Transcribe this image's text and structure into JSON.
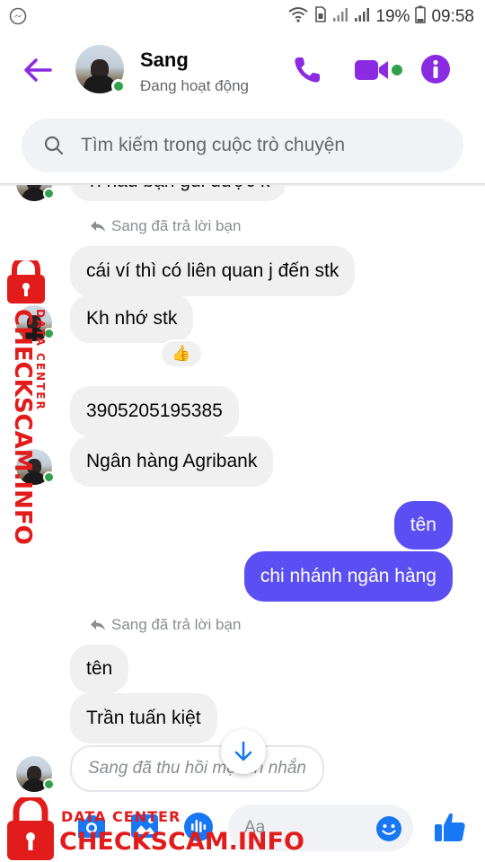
{
  "status_bar": {
    "battery": "19%",
    "time": "09:58"
  },
  "header": {
    "contact_name": "Sang",
    "contact_status": "Đang hoạt động"
  },
  "search": {
    "placeholder": "Tìm kiếm trong cuộc trò chuyện"
  },
  "messages": {
    "cut_off_top": "Ti nau bạn gui được k",
    "reply_note_1": "Sang đã trả lời bạn",
    "msg1": "cái ví thì có liên quan j đến stk",
    "msg2": "Kh nhớ stk",
    "reaction": "👍",
    "msg3": "3905205195385",
    "msg4": "Ngân hàng Agribank",
    "mine1": "tên",
    "mine2": "chi nhánh ngân hàng",
    "reply_note_2": "Sang đã trả lời bạn",
    "msg5": "tên",
    "msg6": "Trần tuấn kiệt",
    "recalled": "Sang đã thu hồi một tin nhắn"
  },
  "composer": {
    "placeholder": "Aa"
  },
  "watermark": {
    "line1": "DATA CENTER",
    "line2": "CHECKSCAM.INFO"
  },
  "colors": {
    "accent": "#5b4ef2",
    "icon_purple": "#8a2be2",
    "online_green": "#31a24c",
    "watermark_red": "#e21b1b"
  }
}
